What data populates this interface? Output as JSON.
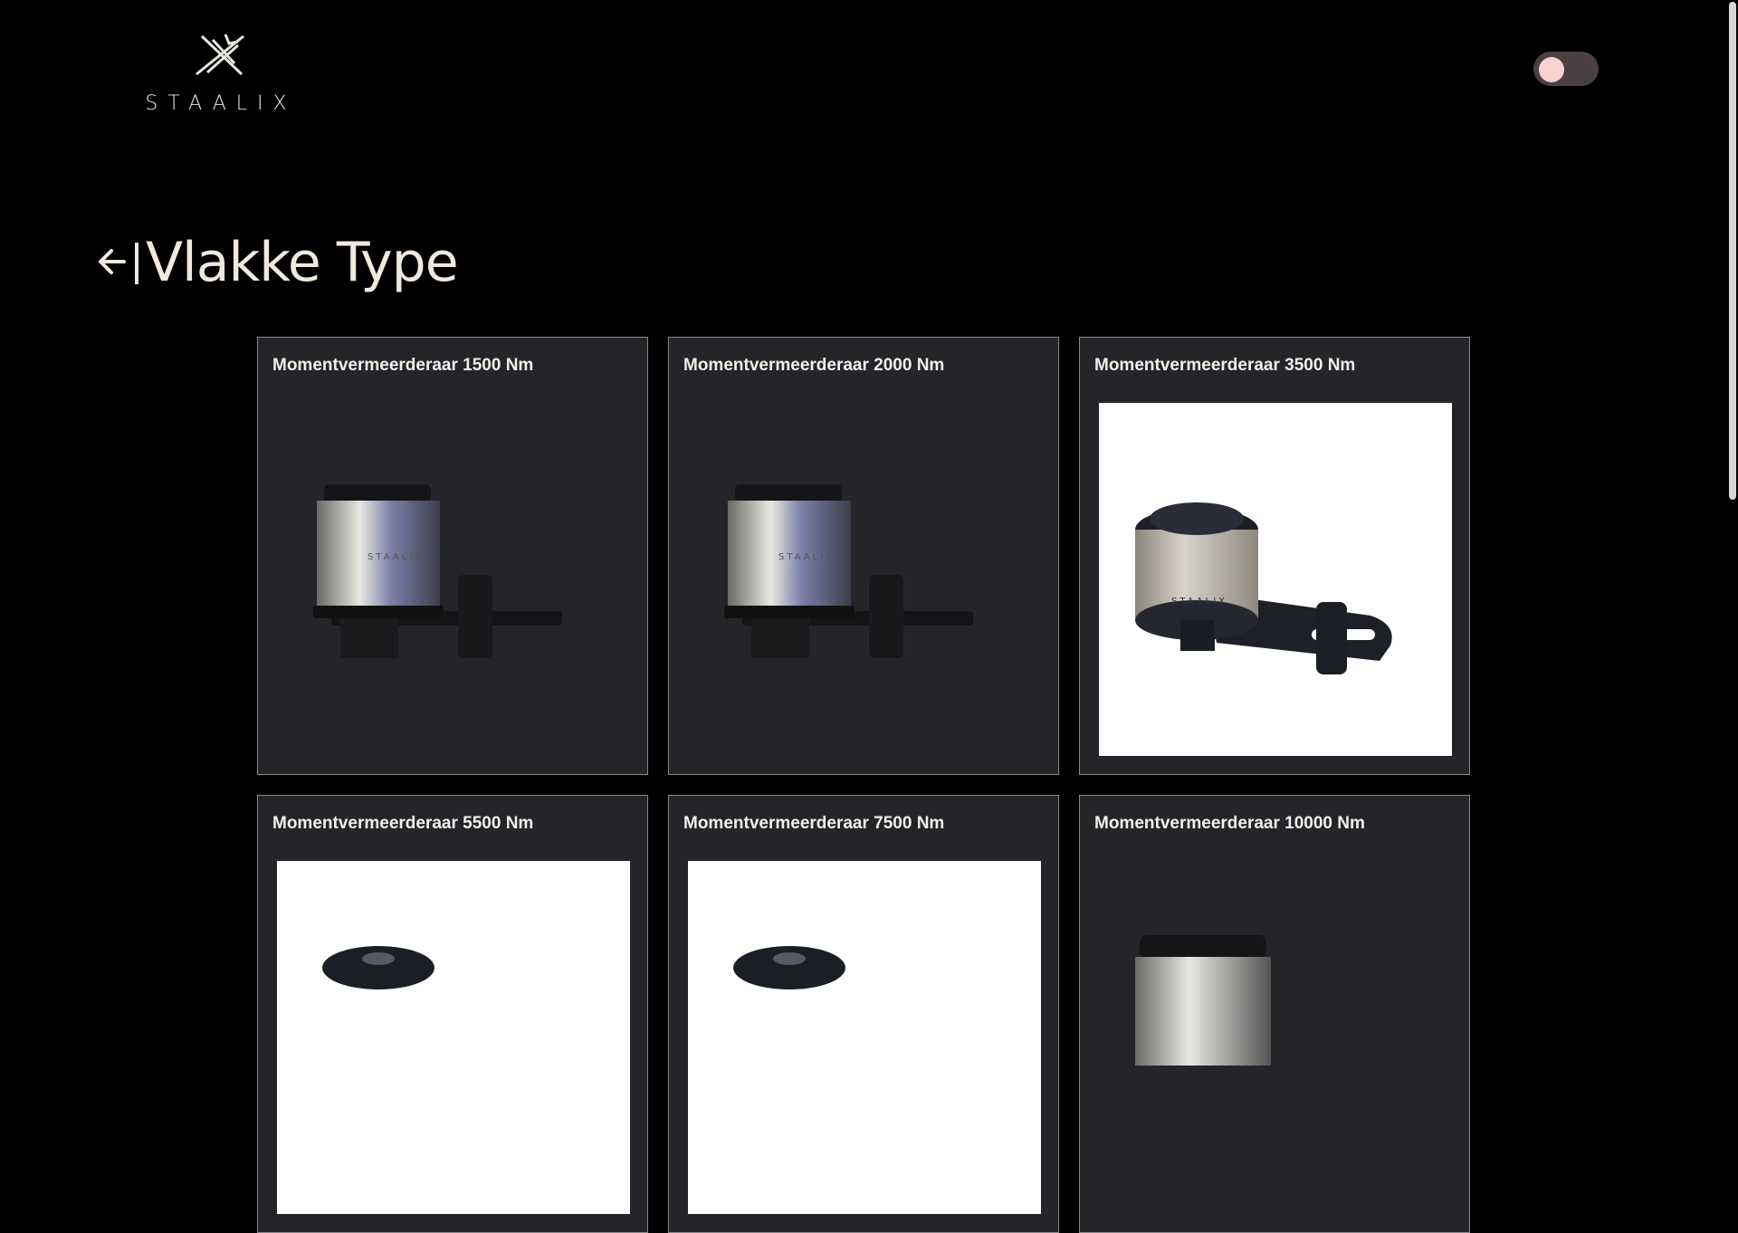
{
  "brand": {
    "name": "STAALIX"
  },
  "header": {
    "theme_toggle": "off"
  },
  "page": {
    "back_icon": "arrow-left-bar-icon",
    "title": "Vlakke Type"
  },
  "products": [
    {
      "title": "Momentvermeerderaar 1500 Nm",
      "image_style": "dark-horizontal"
    },
    {
      "title": "Momentvermeerderaar 2000 Nm",
      "image_style": "dark-horizontal"
    },
    {
      "title": "Momentvermeerderaar 3500 Nm",
      "image_style": "white-angled"
    },
    {
      "title": "Momentvermeerderaar 5500 Nm",
      "image_style": "white-angled"
    },
    {
      "title": "Momentvermeerderaar 7500 Nm",
      "image_style": "white-angled"
    },
    {
      "title": "Momentvermeerderaar 10000 Nm",
      "image_style": "dark-horizontal"
    }
  ],
  "colors": {
    "background": "#000000",
    "card": "#252429",
    "toggle_track": "#4a4042",
    "toggle_knob": "#f6d2d4"
  }
}
